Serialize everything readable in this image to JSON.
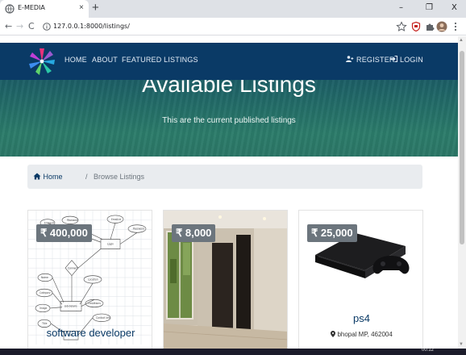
{
  "browser": {
    "tab_title": "E-MEDIA",
    "tab_close": "×",
    "new_tab": "+",
    "window_controls": {
      "minimize": "–",
      "restore": "❐",
      "close": "X"
    },
    "nav": {
      "back": "←",
      "forward": "→",
      "reload": "C"
    },
    "url": "127.0.0.1:8000/listings/",
    "icons": [
      "star-icon",
      "shield-extension-icon",
      "puzzle-extensions-icon",
      "profile-avatar-icon",
      "more-menu-icon"
    ]
  },
  "navbar": {
    "links": [
      "HOME",
      "ABOUT",
      "FEATURED LISTINGS"
    ],
    "register": "REGISTER",
    "login": "LOGIN",
    "bg_color": "#0a3a66"
  },
  "showcase": {
    "title": "Available Listings",
    "subtitle": "This are the current published listings"
  },
  "breadcrumb": {
    "home": "Home",
    "separator": "/",
    "current": "Browse Listings"
  },
  "listings": [
    {
      "price": "₹ 400,000",
      "title": "software developer",
      "location": ""
    },
    {
      "price": "₹ 8,000",
      "title": "",
      "location": ""
    },
    {
      "price": "₹ 25,000",
      "title": "ps4",
      "location": "bhopal MP, 462004"
    }
  ],
  "taskbar": {
    "time": "00:12"
  }
}
